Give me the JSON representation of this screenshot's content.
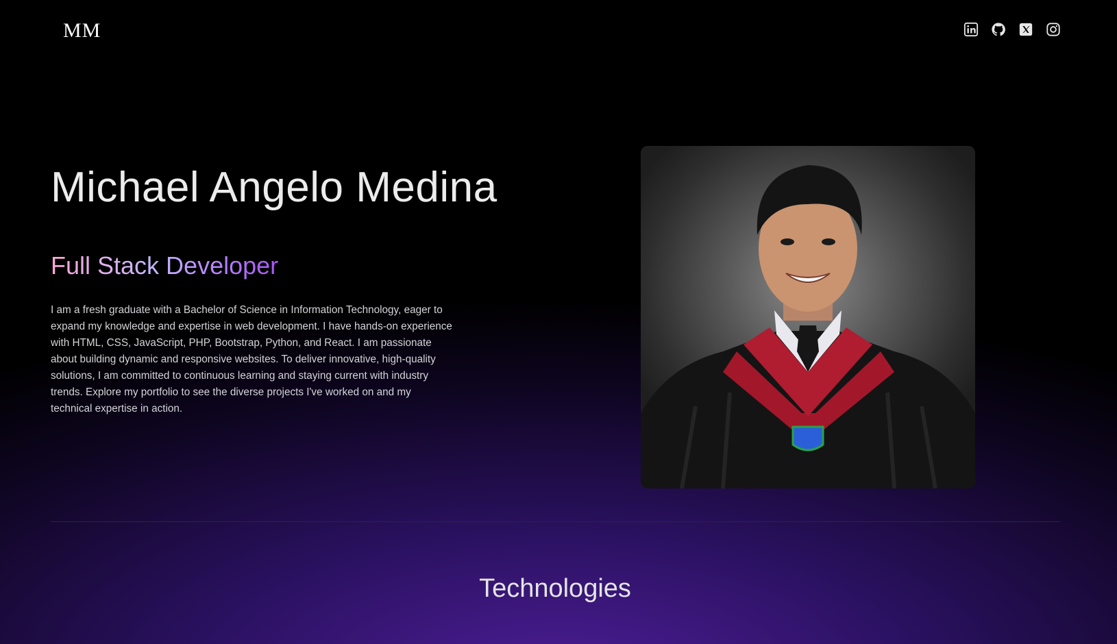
{
  "nav": {
    "logo": "MM",
    "socials": [
      {
        "icon": "linkedin-icon",
        "label": "LinkedIn"
      },
      {
        "icon": "github-icon",
        "label": "GitHub"
      },
      {
        "icon": "x-icon",
        "label": "X"
      },
      {
        "icon": "instagram-icon",
        "label": "Instagram"
      }
    ]
  },
  "hero": {
    "name": "Michael Angelo Medina",
    "role": "Full Stack Developer",
    "bio": "I am a fresh graduate with a Bachelor of Science in Information Technology, eager to expand my knowledge and expertise in web development. I have hands-on experience with HTML, CSS, JavaScript, PHP, Bootstrap, Python, and React. I am passionate about building dynamic and responsive websites. To deliver innovative, high-quality solutions, I am committed to continuous learning and staying current with industry trends. Explore my portfolio to see the diverse projects I've worked on and my technical expertise in action.",
    "photo_alt": "Michael Angelo Medina"
  },
  "sections": {
    "technologies_title": "Technologies"
  },
  "colors": {
    "background_top": "#000000",
    "background_glow": "#4c1d95",
    "role_gradient_start": "#f9a8d4",
    "role_gradient_end": "#a855f7"
  }
}
